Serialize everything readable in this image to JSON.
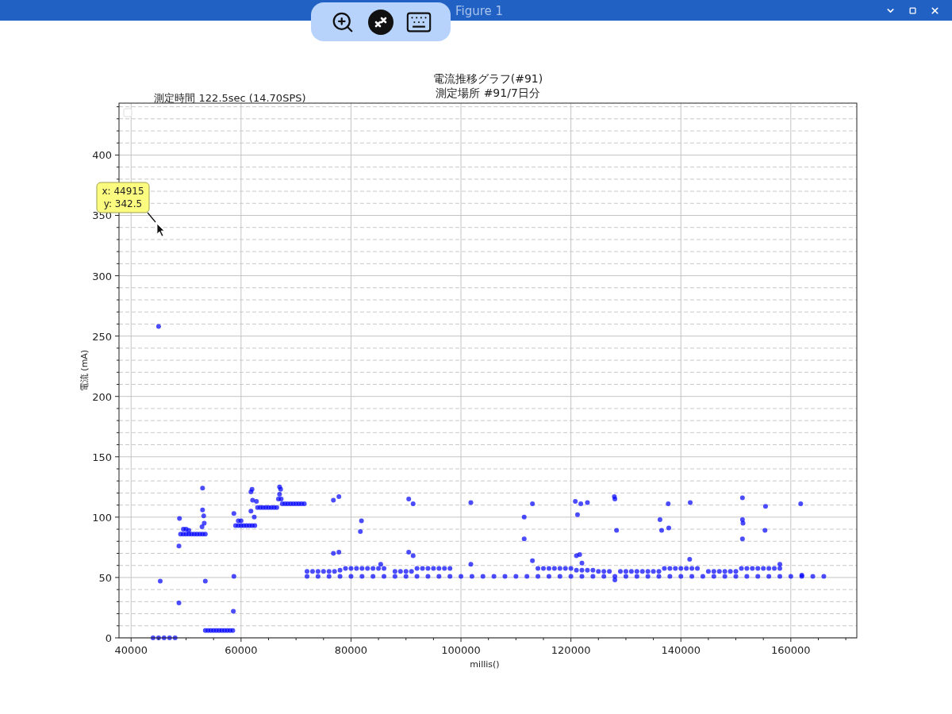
{
  "window": {
    "title": "Figure 1"
  },
  "overlay_toolbar": [
    {
      "kind": "zoom"
    },
    {
      "kind": "remote"
    },
    {
      "kind": "keyboard"
    }
  ],
  "window_controls": [
    {
      "kind": "minimize"
    },
    {
      "kind": "maximize"
    },
    {
      "kind": "close"
    }
  ],
  "figure": {
    "subtitle": "測定時間 122.5sec (14.70SPS)",
    "chart_data": {
      "type": "scatter",
      "title": "電流推移グラフ(#91)\n測定場所 #91/7日分",
      "xlabel": "millis()",
      "ylabel": "電流 (mA)",
      "xlim": [
        37800,
        172000
      ],
      "ylim": [
        0,
        443
      ],
      "xticks": [
        40000,
        60000,
        80000,
        100000,
        120000,
        140000,
        160000
      ],
      "yticks": [
        0,
        50,
        100,
        150,
        200,
        250,
        300,
        350,
        400
      ],
      "grid": true,
      "annotations": [
        {
          "text": [
            "x: 44915",
            "y: 342.5"
          ]
        }
      ],
      "x": [
        44000,
        45000,
        46000,
        47000,
        48000,
        45000,
        45300,
        48700,
        48700,
        48800,
        49000,
        49500,
        50000,
        50500,
        51000,
        51500,
        52000,
        52500,
        53000,
        53500,
        49500,
        50000,
        50500,
        52900,
        53000,
        53000,
        53200,
        53300,
        53500,
        53500,
        54000,
        54500,
        55000,
        55500,
        56000,
        56500,
        57000,
        57500,
        58000,
        58500,
        58600,
        58700,
        58700,
        59000,
        59500,
        60000,
        60500,
        61000,
        61500,
        62000,
        62500,
        59500,
        60000,
        61800,
        62000,
        61800,
        62100,
        62400,
        62800,
        63000,
        63500,
        64000,
        64500,
        65000,
        65500,
        66000,
        66500,
        66800,
        67000,
        67200,
        67000,
        67300,
        67500,
        68000,
        68500,
        69000,
        69500,
        70000,
        70500,
        71000,
        71500,
        76800,
        77800,
        76800,
        77800,
        81700,
        81900,
        85400,
        72000,
        74000,
        76000,
        78000,
        80000,
        82000,
        84000,
        86000,
        88000,
        90000,
        92000,
        94000,
        96000,
        98000,
        100000,
        102000,
        104000,
        106000,
        108000,
        110000,
        112000,
        114000,
        116000,
        118000,
        120000,
        122000,
        124000,
        126000,
        128000,
        130000,
        132000,
        134000,
        136000,
        138000,
        140000,
        142000,
        144000,
        146000,
        148000,
        150000,
        152000,
        154000,
        156000,
        158000,
        160000,
        162000,
        164000,
        166000,
        72000,
        73000,
        74000,
        75000,
        76000,
        77000,
        78000,
        79000,
        80000,
        81000,
        82000,
        83000,
        84000,
        85000,
        86000,
        88000,
        89000,
        90000,
        91000,
        92000,
        93000,
        94000,
        95000,
        96000,
        97000,
        98000,
        114000,
        115000,
        116000,
        117000,
        118000,
        119000,
        120000,
        121000,
        122000,
        123000,
        124000,
        125000,
        126000,
        127000,
        129000,
        130000,
        131000,
        132000,
        133000,
        134000,
        135000,
        136000,
        137000,
        138000,
        139000,
        140000,
        141000,
        142000,
        143000,
        145000,
        146000,
        147000,
        148000,
        149000,
        150000,
        151000,
        152000,
        153000,
        154000,
        155000,
        156000,
        157000,
        158000,
        90500,
        91300,
        90500,
        91300,
        101800,
        101800,
        111500,
        111500,
        113000,
        113000,
        120800,
        121200,
        121800,
        123000,
        121000,
        121600,
        122000,
        127900,
        128000,
        128300,
        128000,
        136200,
        136500,
        137700,
        137800,
        141700,
        141600,
        151200,
        151200,
        151300,
        151200,
        155400,
        155300,
        158000,
        161800,
        162000
      ],
      "series": [
        {
          "color": "#0000ff",
          "values": [
            0,
            0,
            0,
            0,
            0,
            258,
            47,
            29,
            76,
            99,
            86,
            86,
            86,
            86,
            86,
            86,
            86,
            86,
            86,
            86,
            90,
            90,
            89,
            92,
            124,
            106,
            101,
            95,
            47,
            6,
            6,
            6,
            6,
            6,
            6,
            6,
            6,
            6,
            6,
            6,
            22,
            51,
            103,
            93,
            93,
            93,
            93,
            93,
            93,
            93,
            93,
            97,
            97,
            121,
            123,
            105,
            114,
            100,
            113,
            108,
            108,
            108,
            108,
            108,
            108,
            108,
            108,
            115,
            125,
            123,
            119,
            115,
            111,
            111,
            111,
            111,
            111,
            111,
            111,
            111,
            111,
            114,
            117,
            70,
            71,
            88,
            97,
            61,
            51,
            51,
            51,
            51,
            51,
            51,
            51,
            51,
            51,
            51,
            51,
            51,
            51,
            51,
            51,
            51,
            51,
            51,
            51,
            51,
            51,
            51,
            51,
            51,
            51,
            51,
            51,
            51,
            51,
            51,
            51,
            51,
            51,
            51,
            51,
            51,
            51,
            51,
            51,
            51,
            51,
            51,
            51,
            51,
            51,
            51,
            51,
            51,
            55,
            55,
            55,
            55,
            55,
            55,
            56,
            57.5,
            57.5,
            57.5,
            57.5,
            57.5,
            57.5,
            57.5,
            57.5,
            55,
            55,
            55,
            55,
            57.5,
            57.5,
            57.5,
            57.5,
            57.5,
            57.5,
            57.5,
            57.5,
            57.5,
            57.5,
            57.5,
            57.5,
            57.5,
            57.5,
            56,
            56,
            56,
            56,
            55,
            55,
            55,
            55,
            55,
            55,
            55,
            55,
            55,
            55,
            55,
            57.5,
            57.5,
            57.5,
            57.5,
            57.5,
            57.5,
            57.5,
            55,
            55,
            55,
            55,
            55,
            55,
            57.5,
            57.5,
            57.5,
            57.5,
            57.5,
            57.5,
            57.5,
            57.5,
            115,
            111,
            71,
            68,
            61,
            112,
            100,
            82,
            111,
            64,
            113,
            102,
            111,
            112,
            68,
            69,
            62,
            117,
            115,
            89,
            48,
            98,
            89,
            111,
            91,
            112,
            65,
            116,
            98,
            95,
            82,
            109,
            89,
            61,
            111,
            52
          ]
        }
      ]
    }
  }
}
